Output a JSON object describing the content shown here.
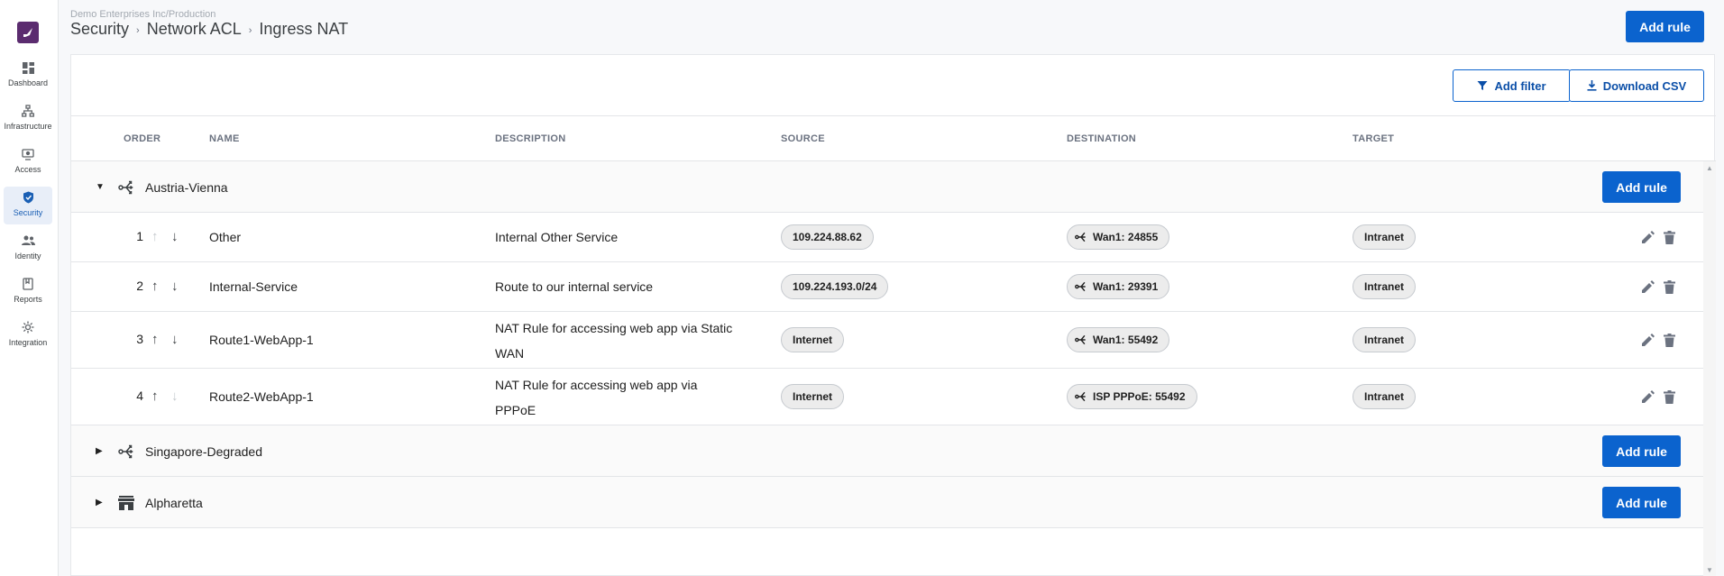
{
  "sidebar": {
    "items": [
      {
        "label": "Dashboard",
        "icon": "dashboard-icon",
        "active": false
      },
      {
        "label": "Infrastructure",
        "icon": "infrastructure-icon",
        "active": false
      },
      {
        "label": "Access",
        "icon": "access-icon",
        "active": false
      },
      {
        "label": "Security",
        "icon": "shield-icon",
        "active": true
      },
      {
        "label": "Identity",
        "icon": "people-icon",
        "active": false
      },
      {
        "label": "Reports",
        "icon": "report-icon",
        "active": false
      },
      {
        "label": "Integration",
        "icon": "integration-icon",
        "active": false
      }
    ]
  },
  "header": {
    "org_path": "Demo Enterprises Inc/Production",
    "breadcrumb": [
      "Security",
      "Network ACL",
      "Ingress NAT"
    ],
    "add_rule_label": "Add rule"
  },
  "toolbar": {
    "add_filter_label": "Add filter",
    "download_csv_label": "Download CSV"
  },
  "table": {
    "columns": [
      "ORDER",
      "NAME",
      "DESCRIPTION",
      "SOURCE",
      "DESTINATION",
      "TARGET"
    ],
    "groups": [
      {
        "name": "Austria-Vienna",
        "expanded": true,
        "icon": "branch-icon",
        "add_rule_label": "Add rule",
        "rules": [
          {
            "order": "1",
            "name": "Other",
            "description": "Internal Other Service",
            "source": "109.224.88.62",
            "destination": "Wan1: 24855",
            "target": "Intranet",
            "up_enabled": false,
            "down_enabled": true
          },
          {
            "order": "2",
            "name": "Internal-Service",
            "description": "Route to our internal service",
            "source": "109.224.193.0/24",
            "destination": "Wan1: 29391",
            "target": "Intranet",
            "up_enabled": true,
            "down_enabled": true
          },
          {
            "order": "3",
            "name": "Route1-WebApp-1",
            "description": "NAT Rule for accessing web app via Static WAN",
            "source": "Internet",
            "destination": "Wan1: 55492",
            "target": "Intranet",
            "up_enabled": true,
            "down_enabled": true
          },
          {
            "order": "4",
            "name": "Route2-WebApp-1",
            "description": "NAT Rule for accessing web app via PPPoE",
            "source": "Internet",
            "destination": "ISP PPPoE: 55492",
            "target": "Intranet",
            "up_enabled": true,
            "down_enabled": false
          }
        ]
      },
      {
        "name": "Singapore-Degraded",
        "expanded": false,
        "icon": "branch-icon",
        "add_rule_label": "Add rule"
      },
      {
        "name": "Alpharetta",
        "expanded": false,
        "icon": "store-icon",
        "add_rule_label": "Add rule"
      }
    ]
  },
  "colors": {
    "accent": "#0b63ce",
    "brand": "#5b2c6f",
    "active_nav_bg": "#e8eef8"
  }
}
